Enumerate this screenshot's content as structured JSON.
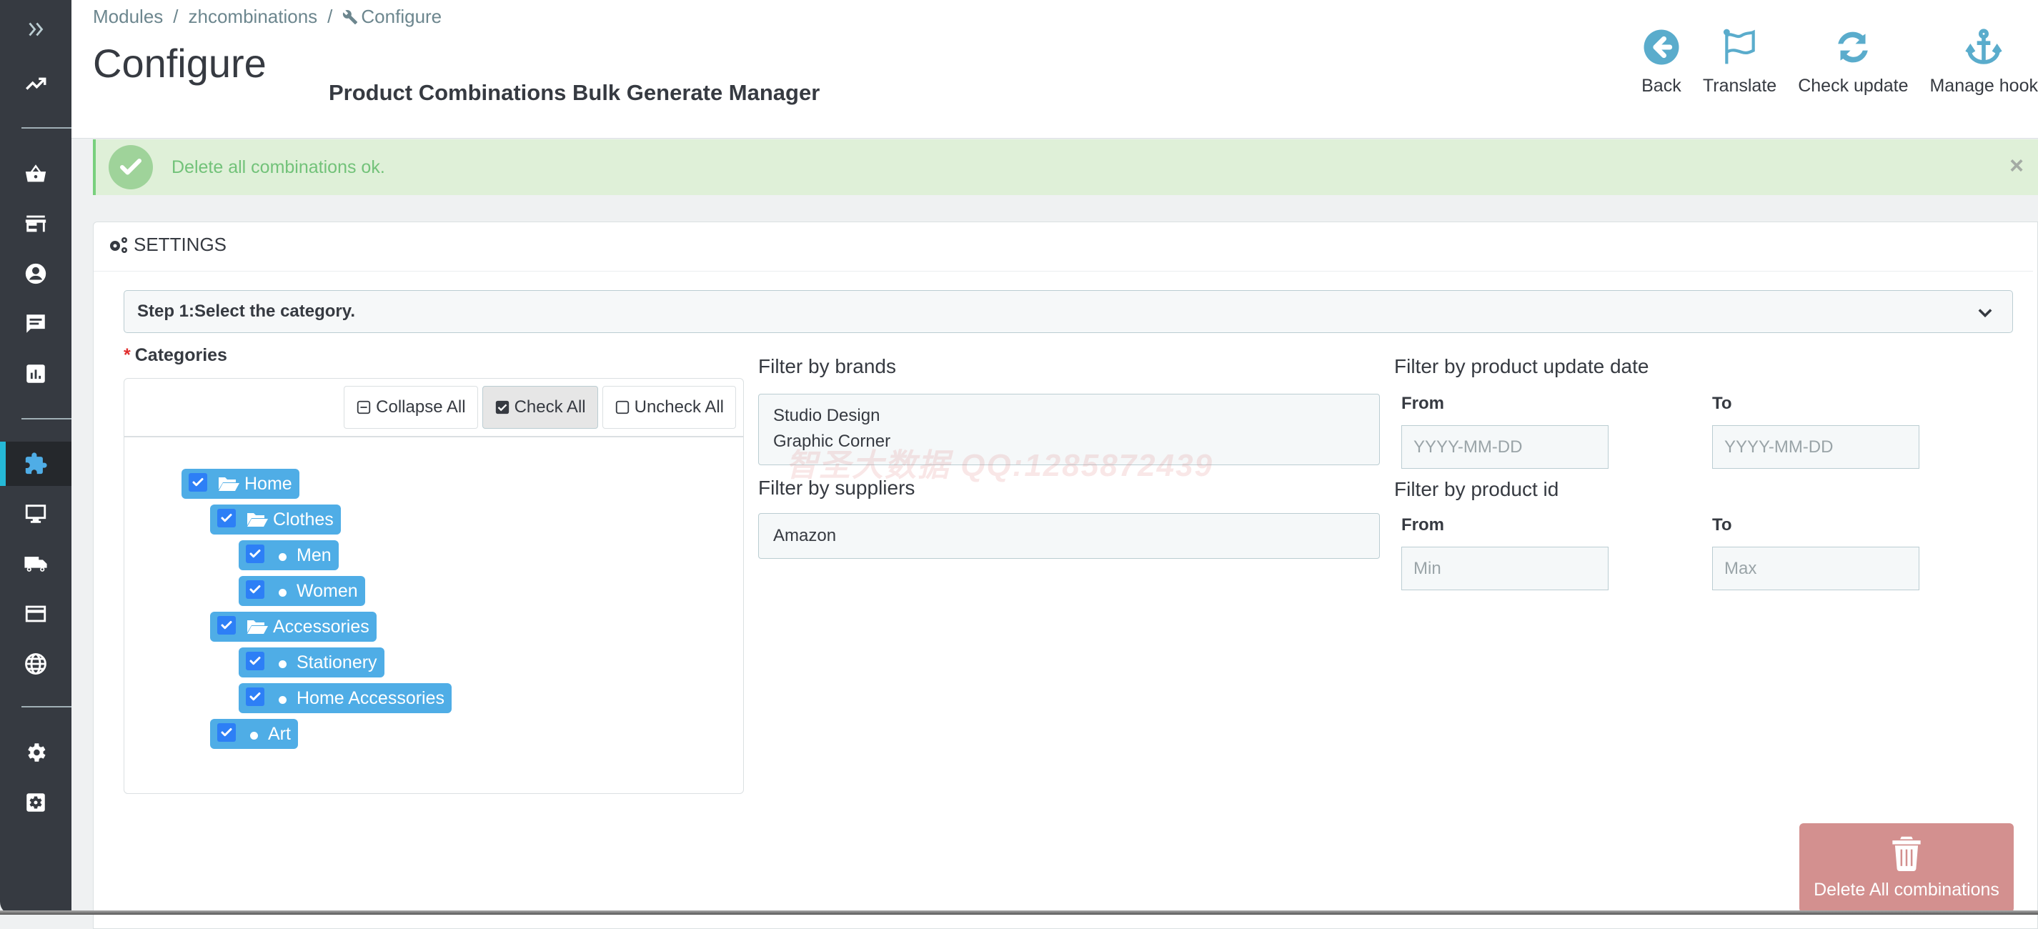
{
  "breadcrumb": {
    "items": [
      "Modules",
      "zhcombinations"
    ],
    "current": "Configure",
    "separator": "/"
  },
  "header": {
    "title": "Configure",
    "subtitle": "Product Combinations Bulk Generate Manager"
  },
  "toolbar": {
    "back": "Back",
    "translate": "Translate",
    "check_update": "Check update",
    "manage_hook": "Manage hook"
  },
  "sidebar": {
    "items": [
      "expand",
      "dashboard",
      "orders",
      "catalog",
      "customers",
      "customer-service",
      "stats",
      "modules",
      "design",
      "shipping",
      "payment",
      "international",
      "configure",
      "advanced-parameters"
    ],
    "active": "modules"
  },
  "alert": {
    "message": "Delete all combinations ok.",
    "close": "×"
  },
  "panel": {
    "title": "SETTINGS",
    "step_label": "Step 1:Select the category."
  },
  "categories": {
    "label": "Categories",
    "required_mark": "*",
    "buttons": {
      "collapse_all": "Collapse All",
      "check_all": "Check All",
      "uncheck_all": "Uncheck All"
    },
    "tree": [
      {
        "label": "Home",
        "level": 0,
        "type": "folder",
        "checked": true
      },
      {
        "label": "Clothes",
        "level": 1,
        "type": "folder",
        "checked": true
      },
      {
        "label": "Men",
        "level": 2,
        "type": "leaf",
        "checked": true
      },
      {
        "label": "Women",
        "level": 2,
        "type": "leaf",
        "checked": true
      },
      {
        "label": "Accessories",
        "level": 1,
        "type": "folder",
        "checked": true
      },
      {
        "label": "Stationery",
        "level": 2,
        "type": "leaf",
        "checked": true
      },
      {
        "label": "Home Accessories",
        "level": 2,
        "type": "leaf",
        "checked": true
      },
      {
        "label": "Art",
        "level": 1,
        "type": "leaf",
        "checked": true
      }
    ]
  },
  "filters": {
    "brands": {
      "label": "Filter by brands",
      "options": [
        "Studio Design",
        "Graphic Corner"
      ]
    },
    "suppliers": {
      "label": "Filter by suppliers",
      "options": [
        "Amazon"
      ]
    },
    "update_date": {
      "label": "Filter by product update date",
      "from_label": "From",
      "to_label": "To",
      "from_placeholder": "YYYY-MM-DD",
      "to_placeholder": "YYYY-MM-DD",
      "from_value": "",
      "to_value": ""
    },
    "product_id": {
      "label": "Filter by product id",
      "from_label": "From",
      "to_label": "To",
      "from_placeholder": "Min",
      "to_placeholder": "Max",
      "from_value": "",
      "to_value": ""
    }
  },
  "watermark": "智圣大数据  QQ:1285872439",
  "actions": {
    "delete_all": "Delete All combinations"
  },
  "colors": {
    "sidebar": "#363a41",
    "accent": "#25b9d7",
    "toolbar_icon": "#5aaccc",
    "tree_node": "#4fade6",
    "success_bg": "#dff0d8",
    "danger_button": "#d3908f"
  }
}
